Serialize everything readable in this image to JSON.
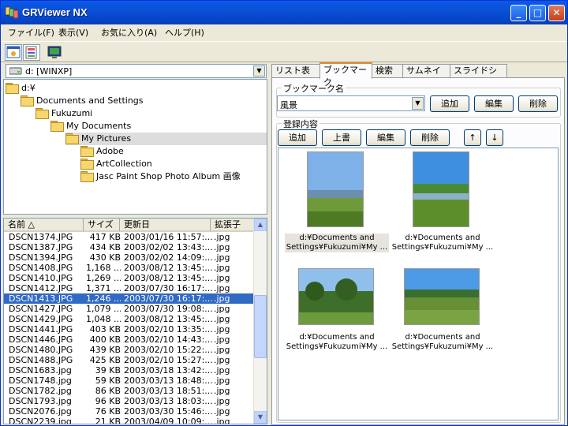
{
  "window": {
    "title": "GRViewer NX"
  },
  "titlebar_buttons": {
    "minimize": "_",
    "maximize": "□",
    "close": "✕"
  },
  "menu": [
    "ファイル(F)",
    "表示(V)",
    "お気に入り(A)",
    "ヘルプ(H)"
  ],
  "drive": {
    "label": "d: [WINXP]"
  },
  "tree": [
    {
      "label": "d:¥",
      "depth": 0
    },
    {
      "label": "Documents and Settings",
      "depth": 1
    },
    {
      "label": "Fukuzumi",
      "depth": 2
    },
    {
      "label": "My Documents",
      "depth": 3
    },
    {
      "label": "My Pictures",
      "depth": 4,
      "selected": true
    },
    {
      "label": "Adobe",
      "depth": 5
    },
    {
      "label": "ArtCollection",
      "depth": 5
    },
    {
      "label": "Jasc Paint Shop Photo Album 画像",
      "depth": 5
    }
  ],
  "filelist": {
    "headers": [
      "名前 △",
      "サイズ",
      "更新日",
      "拡張子"
    ],
    "rows": [
      [
        "DSCN1374.JPG",
        "417 KB",
        "2003/01/16 11:57:...",
        ".jpg"
      ],
      [
        "DSCN1387.JPG",
        "434 KB",
        "2003/02/02 13:43:...",
        ".jpg"
      ],
      [
        "DSCN1394.JPG",
        "430 KB",
        "2003/02/02 14:09:...",
        ".jpg"
      ],
      [
        "DSCN1408.JPG",
        "1,168 ...",
        "2003/08/12 13:45:...",
        ".jpg"
      ],
      [
        "DSCN1410.JPG",
        "1,269 ...",
        "2003/08/12 13:45:...",
        ".jpg"
      ],
      [
        "DSCN1412.JPG",
        "1,371 ...",
        "2003/07/30 16:17:...",
        ".jpg"
      ],
      [
        "DSCN1413.JPG",
        "1,246 ...",
        "2003/07/30 16:17:...",
        ".jpg"
      ],
      [
        "DSCN1427.JPG",
        "1,079 ...",
        "2003/07/30 19:08:...",
        ".jpg"
      ],
      [
        "DSCN1429.JPG",
        "1,048 ...",
        "2003/08/12 13:45:...",
        ".jpg"
      ],
      [
        "DSCN1441.JPG",
        "403 KB",
        "2003/02/10 13:35:...",
        ".jpg"
      ],
      [
        "DSCN1446.JPG",
        "400 KB",
        "2003/02/10 14:43:...",
        ".jpg"
      ],
      [
        "DSCN1480.JPG",
        "439 KB",
        "2003/02/10 15:22:...",
        ".jpg"
      ],
      [
        "DSCN1488.JPG",
        "425 KB",
        "2003/02/10 15:27:...",
        ".jpg"
      ],
      [
        "DSCN1683.jpg",
        "39 KB",
        "2003/03/18 13:42:...",
        ".jpg"
      ],
      [
        "DSCN1748.jpg",
        "59 KB",
        "2003/03/13 18:48:...",
        ".jpg"
      ],
      [
        "DSCN1782.jpg",
        "86 KB",
        "2003/03/13 18:51:...",
        ".jpg"
      ],
      [
        "DSCN1793.jpg",
        "96 KB",
        "2003/03/13 18:03:...",
        ".jpg"
      ],
      [
        "DSCN2076.jpg",
        "76 KB",
        "2003/03/30 15:46:...",
        ".jpg"
      ],
      [
        "DSCN2239.jpg",
        "21 KB",
        "2003/04/09 10:09:...",
        ".jpg"
      ]
    ],
    "selected_index": 6
  },
  "tabs": [
    "リスト表示",
    "ブックマーク",
    "検索",
    "サムネイル",
    "スライドショー"
  ],
  "active_tab": 1,
  "bookmark": {
    "group_label": "ブックマーク名",
    "selected": "風景",
    "buttons": [
      "追加",
      "編集",
      "削除"
    ]
  },
  "contents": {
    "group_label": "登録内容",
    "buttons": [
      "追加",
      "上書",
      "編集",
      "削除",
      "↑",
      "↓"
    ],
    "thumbs": [
      {
        "line1": "d:¥Documents and",
        "line2": "Settings¥Fukuzumi¥My ...",
        "highlight": true
      },
      {
        "line1": "d:¥Documents and",
        "line2": "Settings¥Fukuzumi¥My ..."
      },
      {
        "line1": "d:¥Documents and",
        "line2": "Settings¥Fukuzumi¥My ..."
      },
      {
        "line1": "d:¥Documents and",
        "line2": "Settings¥Fukuzumi¥My ..."
      }
    ]
  },
  "colors": {
    "selection": "#316ac5",
    "titlebar": "#0a5ae8",
    "tab_accent": "#e68b2c"
  }
}
